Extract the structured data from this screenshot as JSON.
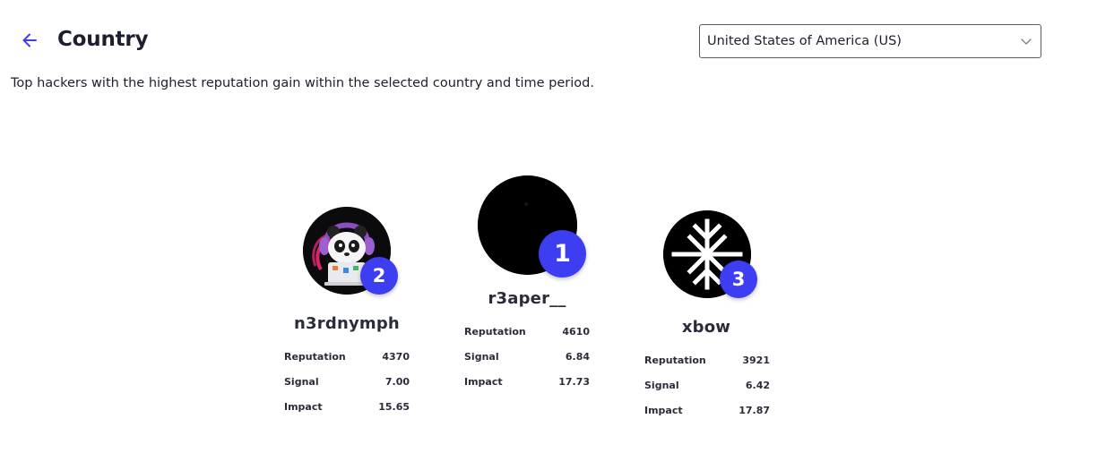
{
  "header": {
    "title": "Country",
    "back_icon": "arrow-left-icon",
    "accent_color": "#3d3df2"
  },
  "country_select": {
    "value": "United States of America (US)",
    "icon": "chevron-down-icon"
  },
  "description": "Top hackers with the highest reputation gain within the selected country and time period.",
  "podium": [
    {
      "rank": "1",
      "username": "r3aper__",
      "stats": [
        {
          "label": "Reputation",
          "value": "4610"
        },
        {
          "label": "Signal",
          "value": "6.84"
        },
        {
          "label": "Impact",
          "value": "17.73"
        }
      ]
    },
    {
      "rank": "2",
      "username": "n3rdnymph",
      "stats": [
        {
          "label": "Reputation",
          "value": "4370"
        },
        {
          "label": "Signal",
          "value": "7.00"
        },
        {
          "label": "Impact",
          "value": "15.65"
        }
      ]
    },
    {
      "rank": "3",
      "username": "xbow",
      "stats": [
        {
          "label": "Reputation",
          "value": "3921"
        },
        {
          "label": "Signal",
          "value": "6.42"
        },
        {
          "label": "Impact",
          "value": "17.87"
        }
      ]
    }
  ],
  "badge_color": "#3d3df2"
}
